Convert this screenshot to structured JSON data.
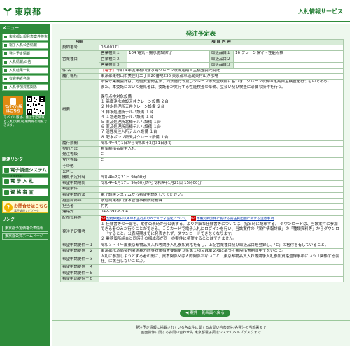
{
  "header": {
    "logo_text": "東京都",
    "service_title": "入札情報サービス"
  },
  "sidebar": {
    "menu_heading": "メニュー",
    "items": [
      "東京都公報発表案件検索",
      "電子入札公告情報",
      "発注予定情報",
      "入札情報/公告",
      "入札結果一覧",
      "有資格者名簿",
      "入札参加資格関係"
    ],
    "mobile": {
      "badge_label": "モバイル版",
      "badge_sub": "はこちら",
      "text": "モバイル版は、発注予定情報と入札(契約)結果情報を閲覧できます。"
    },
    "link_heading": "関連リンク",
    "big_links": [
      "電子調達システム(TOP)",
      "電 子 入 札",
      "資 格 審 査"
    ],
    "manual": {
      "title": "お問合せはこちら",
      "sub": "電子調達ナビゲータ"
    },
    "links_heading": "リンク",
    "links": [
      "東京都予定価格公表情報",
      "東京都公式ホームページ"
    ]
  },
  "main": {
    "page_title": "発注予定表",
    "table_header": {
      "item": "項目",
      "content": "項 目 内 容"
    },
    "contract_number": {
      "label": "契約番号",
      "value": "03-00371"
    },
    "business_kind": {
      "label": "営業種目",
      "rows": [
        {
          "label": "営業種目１",
          "value": "104 電気・揚水施設保守",
          "sub_label": "取扱品目１",
          "sub_value": "16 クレーン保守・性能点検"
        },
        {
          "label": "営業種目２",
          "value": "",
          "sub_label": "取扱品目２",
          "sub_value": ""
        },
        {
          "label": "営業種目３",
          "value": "",
          "sub_label": "取扱品目３",
          "sub_value": ""
        }
      ]
    },
    "subject": {
      "label": "件 名",
      "tag": "【電子】",
      "value": "令和４年度東村山浄水場クレーン設備定期自主検査委託委託"
    },
    "location": {
      "label": "履行場所",
      "value": "東京都東村山市美住町二丁目20番地236 東京都水道局東村山浄水場"
    },
    "summary": {
      "label": "概要",
      "value": "本保守業務委託は、労働安全衛生法、同法施行令及びクレーン等安全規則に基づき、クレーン設備の定期自主検査を行うものである。\nまた、本委託において発見者は、委託者が実行する性能検査の準備、立会い及び検査に必要な操作を行う。\n\n保守点検対象設備\n１ 高度浄水施設天井クレーン設備 ２台\n２ 排水処理所天井クレーン設備 ２台\n３ 排水処理所テルハ設備 １台\n４ １急速設置テルハ設備 １台\n５ 薬品処理所北棟テルハ設備 １台\n６ 薬品処理所南棟テルハ設備 １台\n７ 活性炭注入所テルハ設備 １台\n８ 配水ポンプ所天井クレーン設備 １台"
    },
    "period": {
      "label": "履行期間",
      "value": "令和4年4月1日から令和5年3月31日まで"
    },
    "contract_method": {
      "label": "契約方法",
      "value": "希望制指名競争入札"
    },
    "order_type": {
      "label": "発注等級",
      "value": "C"
    },
    "acceptance_grade": {
      "label": "受付等級",
      "value": "C"
    },
    "other": {
      "label": "その他",
      "value": ""
    },
    "announce_date": {
      "label": "公告日",
      "value": ""
    },
    "plan_date": {
      "label": "開札予定日時",
      "value": "令和4年2月21日 9時00分"
    },
    "application_period": {
      "label": "希望申請期間",
      "value": "令和4年1月17日 9時00分から令和4年1月21日 15時00分"
    },
    "application_conditions": {
      "label": "希望条件",
      "value": ""
    },
    "application_method": {
      "label": "希望申請方法",
      "value": "電子調達システムから希望申請をしてください。"
    },
    "department": {
      "label": "担当局部課",
      "value": "水道局東村山浄水管理事務所総務課"
    },
    "person": {
      "label": "担当者",
      "value": "竹内"
    },
    "contact": {
      "label": "連絡先",
      "value": "042-397-8204"
    },
    "distribution": {
      "label": "配布資料等",
      "link1": "契約締結日以降の不正行為のペナルティ強化について",
      "link2": "準備契約案件における責任負担額に関する注意事項"
    },
    "notes": {
      "label": "発注予定備考",
      "value": "１ 仕様書等の一部を、案件公表時から公表する。より詳細な仕様書等については、指名時に配布する。 ダウンロードは、当該案件に参加できる者のみが行うことができる。ＩＣカードで電子入札にログインを行い、当該案件の「案件情報詳細」の「種類資料等」からダウンロードすること。公表時期までに発表されず、ダウンロードできなくなります。\n２ 業務個所組合と同時その構成員が同一の案件に希望することはできません。"
    },
    "conditions": [
      {
        "label": "希望申請要件－１",
        "value": "令和３・４年度東京都物品買入れ等競争入札参加資格を有し、上記営業種目及び取扱品目を登録し、「C」の格付を有していること。"
      },
      {
        "label": "希望申請要件－２",
        "value": "東京都水道局契約関係暴力団等対策措置要綱第３条第１項又は第２項に基づく排除措置期間中でないこと。"
      },
      {
        "label": "希望申請要件－３",
        "value": "入札に参加しようとする者の間に、資本関係又は人的関係がないこと（東京都物品買入れ等競争入札参加資格登録事項にいう「関係する会社」に該当しないこと。）。"
      },
      {
        "label": "希望申請要件－４",
        "value": ""
      },
      {
        "label": "希望申請要件－５",
        "value": ""
      },
      {
        "label": "希望申請要件－６",
        "value": ""
      }
    ],
    "back_button": "案件一覧画面へ戻る",
    "footer": [
      "発注予定情報に掲載されている各案件に関するお問い合わせ先 各発注担当部署まで",
      "画面操作に関するお問い合わせ先 東京都電子調達システムヘルプデスクまで"
    ]
  },
  "colors": {
    "brand_green": "#2e8b3a",
    "label_bg": "#d7ebd7",
    "page_bg": "#eef8ee"
  }
}
